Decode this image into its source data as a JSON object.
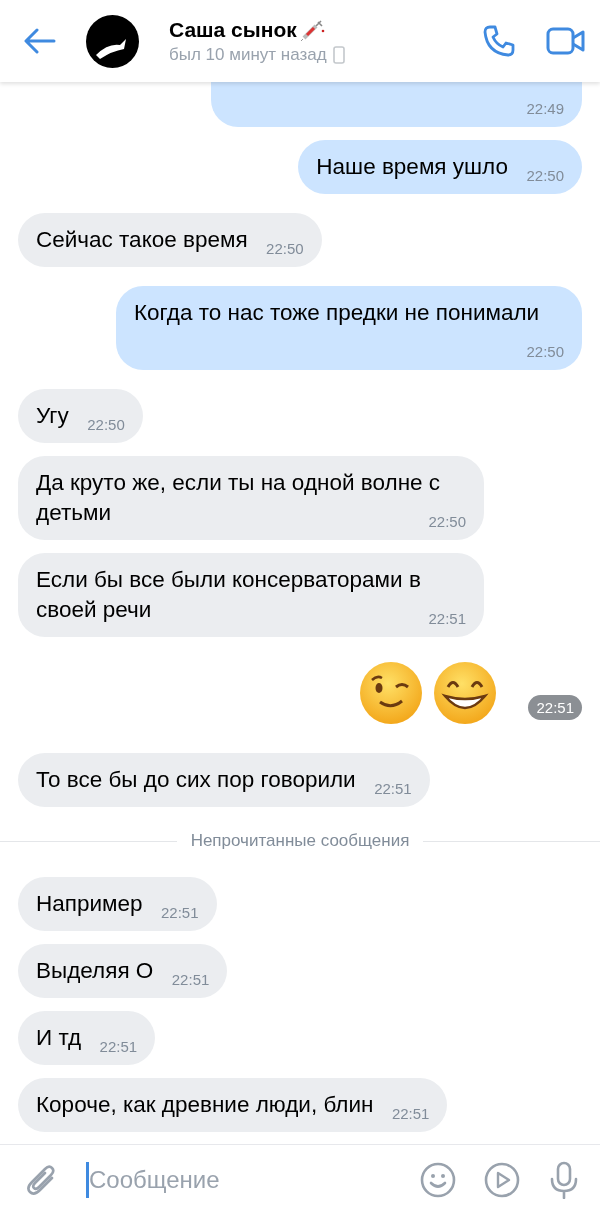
{
  "header": {
    "name": "Саша сынок",
    "status": "был 10 минут назад"
  },
  "messages": [
    {
      "kind": "cut_off",
      "outgoing": true,
      "time": "22:49"
    },
    {
      "kind": "text",
      "outgoing": true,
      "text": "Наше время ушло",
      "time": "22:50"
    },
    {
      "kind": "text",
      "outgoing": false,
      "text": "Сейчас такое время",
      "time": "22:50"
    },
    {
      "kind": "text",
      "outgoing": true,
      "text": "Когда то нас тоже предки не понимали",
      "time": "22:50"
    },
    {
      "kind": "text",
      "outgoing": false,
      "text": "Угу",
      "time": "22:50"
    },
    {
      "kind": "text",
      "outgoing": false,
      "text": "Да круто же, если ты на одной волне с детьми",
      "time": "22:50"
    },
    {
      "kind": "text",
      "outgoing": false,
      "text": "Если бы все были консерваторами в своей речи",
      "time": "22:51"
    },
    {
      "kind": "emoji",
      "outgoing": true,
      "emojis": [
        {
          "kind": "wink"
        },
        {
          "kind": "grin"
        }
      ],
      "time": "22:51"
    },
    {
      "kind": "text",
      "outgoing": false,
      "text": "То все бы до сих пор говорили",
      "time": "22:51"
    },
    {
      "kind": "divider",
      "text": "Непрочитанные сообщения"
    },
    {
      "kind": "text",
      "outgoing": false,
      "text": "Например",
      "time": "22:51"
    },
    {
      "kind": "text",
      "outgoing": false,
      "text": "Выделяя О",
      "time": "22:51"
    },
    {
      "kind": "text",
      "outgoing": false,
      "text": "И тд",
      "time": "22:51"
    },
    {
      "kind": "text",
      "outgoing": false,
      "text": "Короче, как древние люди, блин",
      "time": "22:51"
    }
  ],
  "composer": {
    "placeholder": "Сообщение"
  }
}
